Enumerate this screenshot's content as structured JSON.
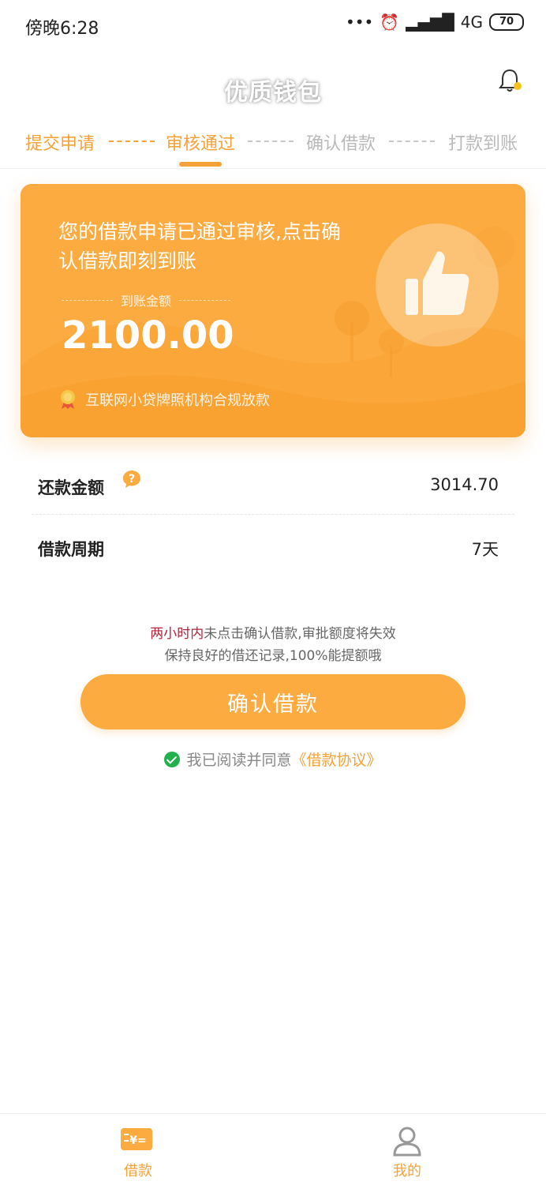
{
  "status_bar": {
    "time": "傍晚6:28",
    "network": "4G",
    "battery": "70"
  },
  "header": {
    "title": "优质钱包"
  },
  "steps": [
    {
      "label": "提交申请",
      "state": "done"
    },
    {
      "label": "审核通过",
      "state": "current"
    },
    {
      "label": "确认借款",
      "state": "pending"
    },
    {
      "label": "打款到账",
      "state": "pending"
    }
  ],
  "card": {
    "message": "您的借款申请已通过审核,点击确认借款即刻到账",
    "amount_label": "到账金额",
    "amount": "2100.00",
    "badge": "互联网小贷牌照机构合规放款"
  },
  "details": [
    {
      "label": "还款金额",
      "value": "3014.70"
    },
    {
      "label": "借款周期",
      "value": "7天"
    }
  ],
  "notice": {
    "highlight": "两小时内",
    "line1_rest": "未点击确认借款,审批额度将失效",
    "line2": "保持良好的借还记录,100%能提额哦"
  },
  "confirm_button": "确认借款",
  "agreement": {
    "prefix": "我已阅读并同意",
    "link": "《借款协议》"
  },
  "tabs": [
    {
      "label": "借款",
      "icon": "loan-icon",
      "active": true
    },
    {
      "label": "我的",
      "icon": "profile-icon",
      "active": false
    }
  ],
  "colors": {
    "accent": "#fbab40",
    "warning": "#b0253c",
    "check": "#22b14c"
  }
}
